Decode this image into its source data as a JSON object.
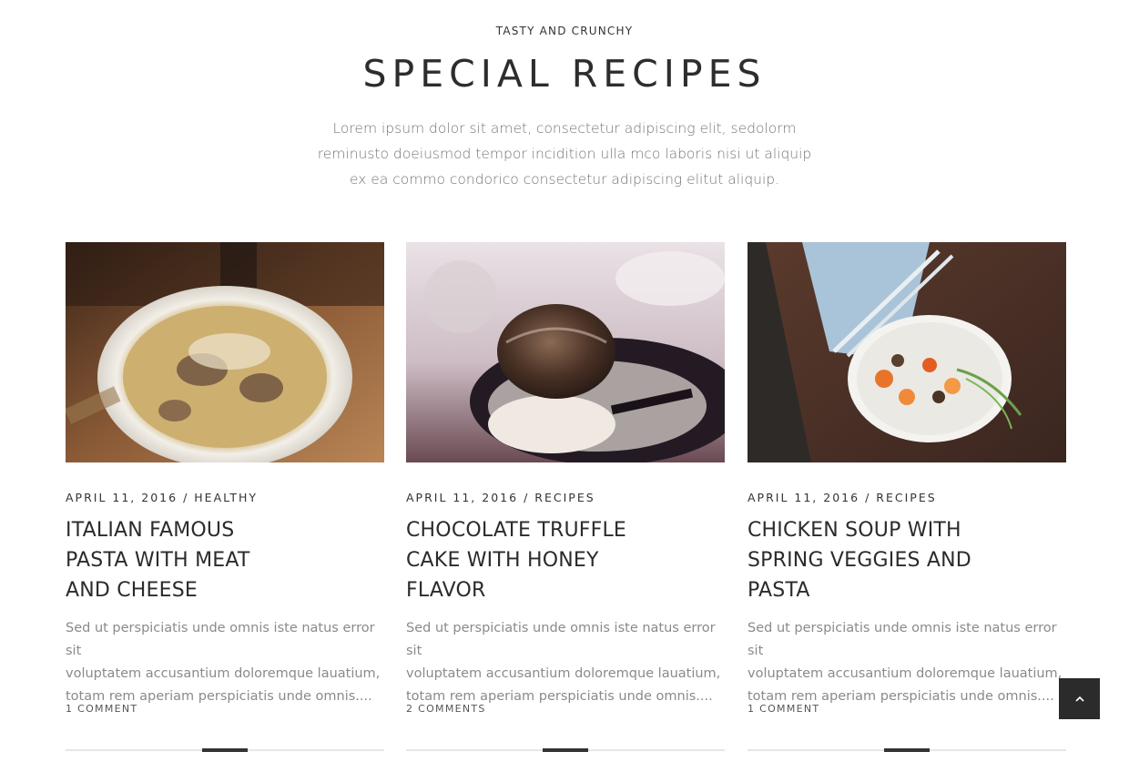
{
  "section": {
    "eyebrow": "TASTY AND CRUNCHY",
    "title": "SPECIAL RECIPES",
    "intro_lines": [
      "Lorem ipsum dolor sit amet, consectetur adipiscing elit, sedolorm",
      "reminusto doeiusmod tempor incidition ulla mco laboris nisi ut aliquip",
      "ex ea commo condorico consectetur adipiscing elitut aliquip."
    ]
  },
  "posts": [
    {
      "image": "pasta-dish-photo",
      "date": "APRIL 11, 2016",
      "separator": "/",
      "category": "HEALTHY",
      "title_lines": [
        "ITALIAN FAMOUS",
        "PASTA WITH MEAT",
        "AND CHEESE"
      ],
      "excerpt_lines": [
        "Sed ut perspiciatis unde omnis iste natus error sit",
        "voluptatem accusantium doloremque lauatium,",
        "totam rem aperiam perspiciatis unde omnis...."
      ],
      "comments": "1 COMMENT"
    },
    {
      "image": "bread-dessert-photo",
      "date": "APRIL 11, 2016",
      "separator": "/",
      "category": "RECIPES",
      "title_lines": [
        "CHOCOLATE TRUFFLE",
        "CAKE WITH HONEY",
        "FLAVOR"
      ],
      "excerpt_lines": [
        "Sed ut perspiciatis unde omnis iste natus error sit",
        "voluptatem accusantium doloremque lauatium,",
        "totam rem aperiam perspiciatis unde omnis...."
      ],
      "comments": "2 COMMENTS"
    },
    {
      "image": "vegetable-plate-photo",
      "date": "APRIL 11, 2016",
      "separator": "/",
      "category": "RECIPES",
      "title_lines": [
        "CHICKEN SOUP WITH",
        "SPRING VEGGIES AND",
        "PASTA"
      ],
      "excerpt_lines": [
        "Sed ut perspiciatis unde omnis iste natus error sit",
        "voluptatem accusantium doloremque lauatium,",
        "totam rem aperiam perspiciatis unde omnis...."
      ],
      "comments": "1 COMMENT"
    }
  ],
  "back_to_top": {
    "icon": "chevron-up-icon"
  },
  "colors": {
    "text_dark": "#2d2d2d",
    "text_muted": "#8a8a8a",
    "accent_bar": "#333333",
    "button_bg": "#2b2b2b"
  }
}
